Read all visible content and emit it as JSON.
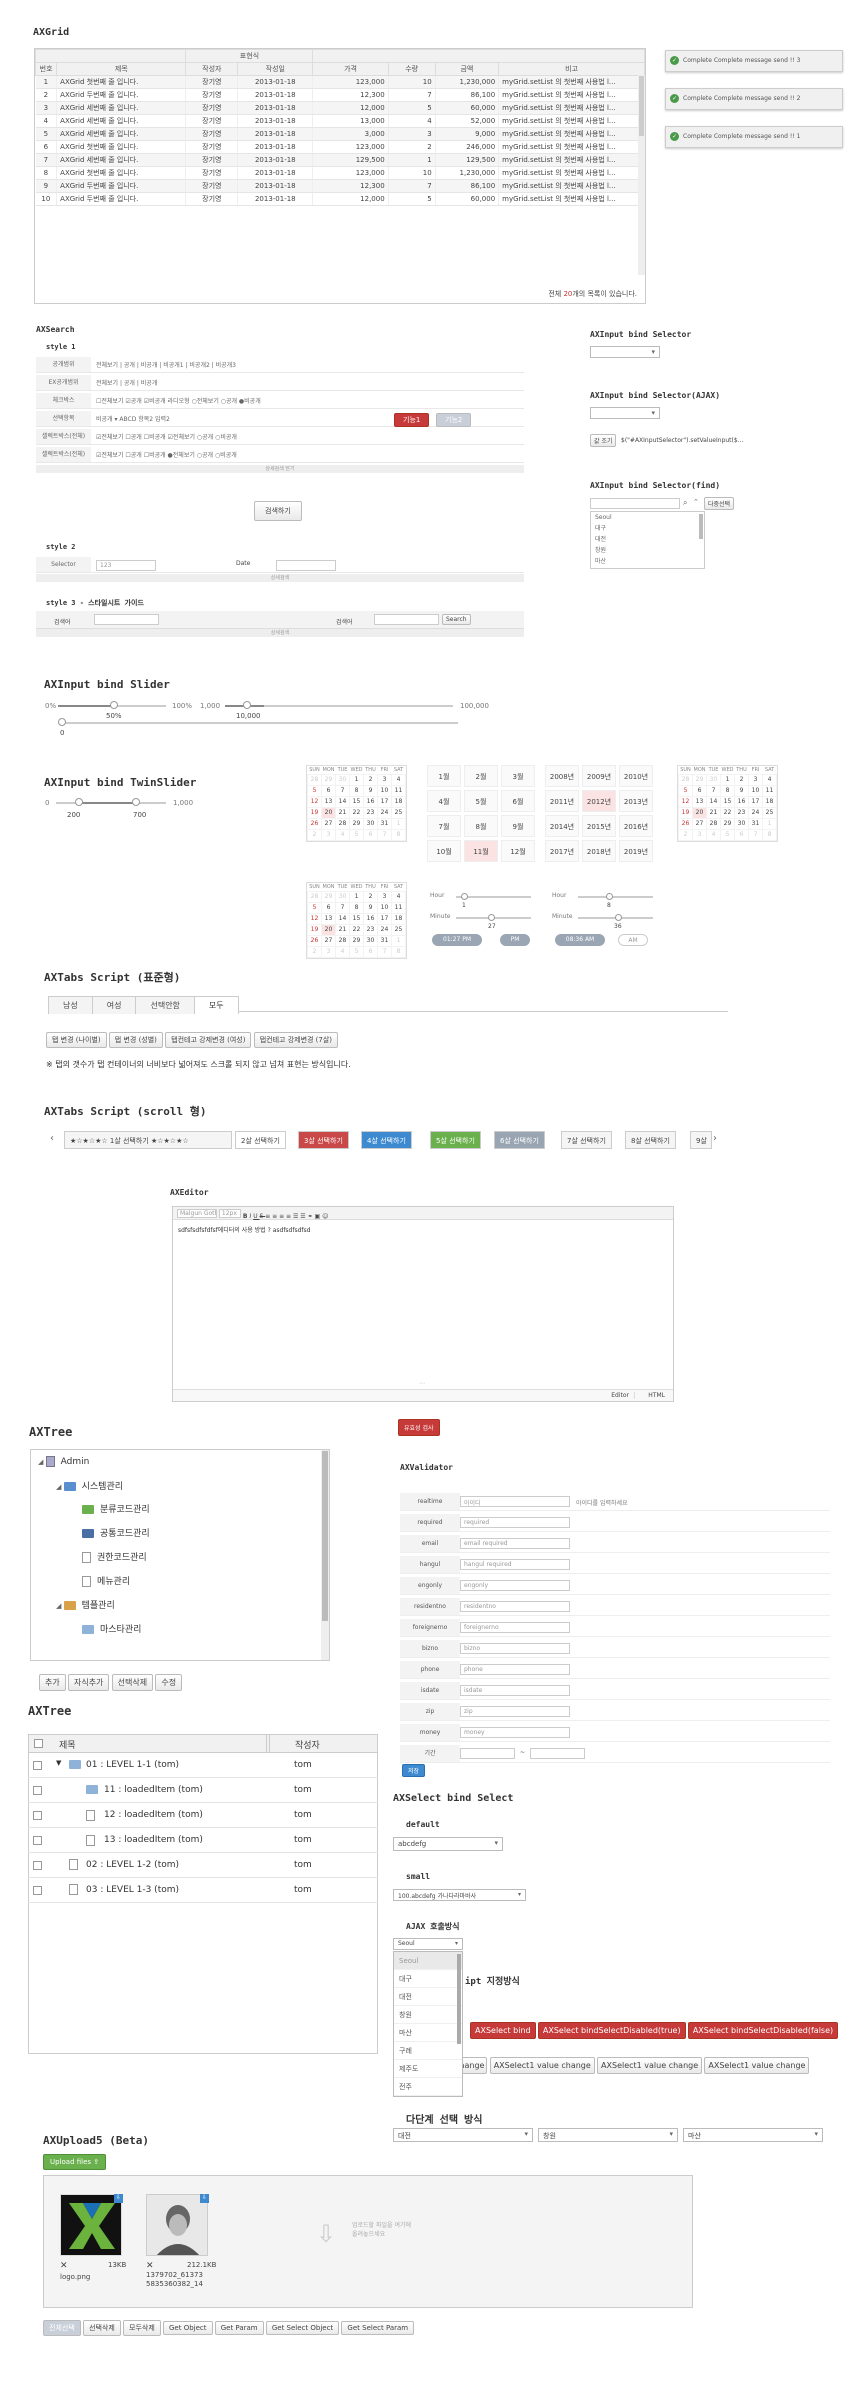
{
  "axgrid": {
    "title": "AXGrid",
    "group_header": "표현식",
    "columns": [
      "번호",
      "제목",
      "작성자",
      "작성일",
      "가격",
      "수량",
      "금액",
      "비고"
    ],
    "rows": [
      [
        "1",
        "AXGrid 첫번째 줄 입니다.",
        "장기영",
        "2013-01-18",
        "123,000",
        "10",
        "1,230,000",
        "myGrid.setList 의 첫번째 사용법 l..."
      ],
      [
        "2",
        "AXGrid 두번째 줄 입니다.",
        "장기영",
        "2013-01-18",
        "12,300",
        "7",
        "86,100",
        "myGrid.setList 의 첫번째 사용법 l..."
      ],
      [
        "3",
        "AXGrid 세번째 줄 입니다.",
        "장기영",
        "2013-01-18",
        "12,000",
        "5",
        "60,000",
        "myGrid.setList 의 첫번째 사용법 l..."
      ],
      [
        "4",
        "AXGrid 세번째 줄 입니다.",
        "장기영",
        "2013-01-18",
        "13,000",
        "4",
        "52,000",
        "myGrid.setList 의 첫번째 사용법 l..."
      ],
      [
        "5",
        "AXGrid 세번째 줄 입니다.",
        "장기영",
        "2013-01-18",
        "3,000",
        "3",
        "9,000",
        "myGrid.setList 의 첫번째 사용법 l..."
      ],
      [
        "6",
        "AXGrid 첫번째 줄 입니다.",
        "장기영",
        "2013-01-18",
        "123,000",
        "2",
        "246,000",
        "myGrid.setList 의 첫번째 사용법 l..."
      ],
      [
        "7",
        "AXGrid 세번째 줄 입니다.",
        "장기영",
        "2013-01-18",
        "129,500",
        "1",
        "129,500",
        "myGrid.setList 의 첫번째 사용법 l..."
      ],
      [
        "8",
        "AXGrid 첫번째 줄 입니다.",
        "장기영",
        "2013-01-18",
        "123,000",
        "10",
        "1,230,000",
        "myGrid.setList 의 첫번째 사용법 l..."
      ],
      [
        "9",
        "AXGrid 두번째 줄 입니다.",
        "장기영",
        "2013-01-18",
        "12,300",
        "7",
        "86,100",
        "myGrid.setList 의 첫번째 사용법 l..."
      ],
      [
        "10",
        "AXGrid 두번째 줄 입니다.",
        "장기영",
        "2013-01-18",
        "12,000",
        "5",
        "60,000",
        "myGrid.setList 의 첫번째 사용법 l..."
      ]
    ],
    "footer_pre": "전체 ",
    "footer_count": "20",
    "footer_post": "개의 목록이 있습니다."
  },
  "toasts": [
    "Complete Complete message send !! 3",
    "Complete Complete message send !! 2",
    "Complete Complete message send !! 1"
  ],
  "axsearch": {
    "title": "AXSearch",
    "style1": "style 1",
    "style2": "style 2",
    "style3": "style 3 - 스타일시트 가이드",
    "rows": [
      [
        "공개범위",
        "전체보기 | 공개 | 비공개 | 비공개1 | 비공개2 | 비공개3"
      ],
      [
        "EX공개범위",
        "전체보기 | 공개 | 비공개"
      ],
      [
        "체크박스",
        "☐전체보기 ☑공개 ☑비공개   라디오형 ○전체보기 ○공개 ●비공개"
      ],
      [
        "선택항목",
        "비공개 ▾  ABCD    항목2  입력2"
      ],
      [
        "셀렉트박스(전체)",
        "☑전체보기 ☐공개 ☐비공개  ☑전체보기 ○공개 ○비공개"
      ],
      [
        "셀렉트박스(전체)",
        "☑전체보기 ☐공개 ☐비공개  ●전체보기 ○공개 ○비공개"
      ]
    ],
    "btn_red": "기능1",
    "btn_gray": "기능2",
    "more": "상세검색 닫기",
    "search_btn": "검색하기",
    "selector_label": "Selector",
    "selector_val": "123",
    "date_label": "Date",
    "detail": "상세검색",
    "s3_label1": "검색어",
    "s3_label2": "검색어",
    "s3_btn": "Search"
  },
  "bind_selector": {
    "title": "AXInput bind Selector",
    "ajax_title": "AXInput bind Selector(AJAX)",
    "ajax_btn": "값 조기",
    "ajax_code": "$(\"#AXInputSelector\").setValueInput($...",
    "find_title": "AXInput bind Selector(find)",
    "find_btn": "다중선택",
    "find_items": [
      "Seoul",
      "대구",
      "대전",
      "창원",
      "마산"
    ]
  },
  "slider": {
    "title": "AXInput bind Slider",
    "min1": "0%",
    "v1": "50%",
    "max1": "100%",
    "min2": "1,000",
    "v2": "10,000",
    "max2": "100,000",
    "v3": "0"
  },
  "twinslider": {
    "title": "AXInput bind TwinSlider",
    "min": "0",
    "max": "1,000",
    "v1": "200",
    "v2": "700"
  },
  "calendar": {
    "days": [
      "SUN",
      "MON",
      "TUE",
      "WED",
      "THU",
      "FRI",
      "SAT"
    ],
    "months": [
      "1월",
      "2월",
      "3월",
      "4월",
      "5월",
      "6월",
      "7월",
      "8월",
      "9월",
      "10월",
      "11월",
      "12월"
    ],
    "years": [
      "2008년",
      "2009년",
      "2010년",
      "2011년",
      "2012년",
      "2013년",
      "2014년",
      "2015년",
      "2016년",
      "2017년",
      "2018년",
      "2019년"
    ],
    "hour": "Hour",
    "minute": "Minute",
    "h1": "1",
    "m1": "27",
    "h2": "8",
    "m2": "36",
    "time1": "01:27 PM",
    "pm": "PM",
    "time2": "08:36 AM",
    "am": "AM"
  },
  "axtabs": {
    "title": "AXTabs Script (표준형)",
    "tabs": [
      "남성",
      "여성",
      "선택안함",
      "모두"
    ],
    "buttons": [
      "탭 변경 (나이별)",
      "탭 변경 (성별)",
      "탭컨테고 강제변경 (여성)",
      "탭컨테고 강제변경 (7살)"
    ],
    "note": "※ 탭의 갯수가 탭 컨테이너의 너비보다 넓어져도 스크롤 되지 않고 넘쳐 표현는 방식입니다."
  },
  "axtabs_scroll": {
    "title": "AXTabs Script (scroll 형)",
    "tabs": [
      "★☆★☆★☆ 1살 선택하기 ★☆★☆★☆",
      "2살 선택하기",
      "3살 선택하기",
      "4살 선택하기",
      "5살 선택하기",
      "6살 선택하기",
      "7살 선택하기",
      "8살 선택하기",
      "9살"
    ]
  },
  "axeditor": {
    "title": "AXEditor",
    "font": "Malgun Gothic",
    "size": "12px",
    "content": "sdfsfsdfsfdfsf에디터의 사용 방법 ? asdfsdfsdfsd",
    "tab_editor": "Editor",
    "tab_html": "HTML"
  },
  "axtree": {
    "title": "AXTree",
    "items": [
      "Admin",
      "시스템관리",
      "분류코드관리",
      "공통코드관리",
      "권한코드관리",
      "메뉴관리",
      "템플관리",
      "마스타관리"
    ],
    "buttons": [
      "추가",
      "자식추가",
      "선택삭제",
      "수정"
    ]
  },
  "axvalidator": {
    "top_btn": "유효성 검사",
    "title": "AXValidator",
    "fields": [
      [
        "realtime",
        "아이디",
        "아이디를 입력하세요"
      ],
      [
        "required",
        "required",
        ""
      ],
      [
        "email",
        "email required",
        ""
      ],
      [
        "hangul",
        "hangul required",
        ""
      ],
      [
        "engonly",
        "engonly",
        ""
      ],
      [
        "residentno",
        "residentno",
        ""
      ],
      [
        "foreignerno",
        "foreignerno",
        ""
      ],
      [
        "bizno",
        "bizno",
        ""
      ],
      [
        "phone",
        "phone",
        ""
      ],
      [
        "isdate",
        "isdate",
        ""
      ],
      [
        "zip",
        "zip",
        ""
      ],
      [
        "money",
        "money",
        ""
      ],
      [
        "기간",
        "",
        ""
      ]
    ],
    "submit": "저장"
  },
  "axtree2": {
    "title": "AXTree",
    "col_title": "제목",
    "col_author": "작성자",
    "rows": [
      [
        "01 : LEVEL 1-1 (tom)",
        "tom"
      ],
      [
        "11 : loadedItem (tom)",
        "tom"
      ],
      [
        "12 : loadedItem (tom)",
        "tom"
      ],
      [
        "13 : loadedItem (tom)",
        "tom"
      ],
      [
        "02 : LEVEL 1-2 (tom)",
        "tom"
      ],
      [
        "03 : LEVEL 1-3 (tom)",
        "tom"
      ]
    ]
  },
  "axselect": {
    "title": "AXSelect bind Select",
    "default_label": "default",
    "default_val": "abcdefg",
    "small_label": "small",
    "small_val": "100.abcdefg 가나다라마바사",
    "ajax_label": "AJAX 호출방식",
    "ajax_val": "Seoul",
    "ajax_options": [
      "Seoul",
      "대구",
      "대전",
      "창원",
      "마산",
      "구례",
      "제주도",
      "전주"
    ],
    "script_label": "ipt 지정방식",
    "buttons_red": [
      "AXSelect bind",
      "AXSelect bindSelectDisabled(true)",
      "AXSelect bindSelectDisabled(false)"
    ],
    "buttons": [
      "change",
      "AXSelect1 value change",
      "AXSelect1 value change",
      "AXSelect1 value change"
    ],
    "multi_label": "다단계 선택 방식",
    "multi": [
      "대전",
      "창원",
      "마산"
    ]
  },
  "axupload": {
    "title": "AXUpload5 (Beta)",
    "upload_btn": "Upload files",
    "files": [
      [
        "logo.png",
        "13KB"
      ],
      [
        "1379702_61373 5835360382_14",
        "212.1KB"
      ]
    ],
    "drop_text": "업로드할 파일을 여기에 올려놓으세요",
    "buttons": [
      "전체선택",
      "선택삭제",
      "모두삭제",
      "Get Object",
      "Get Param",
      "Get Select Object",
      "Get Select Param"
    ]
  }
}
